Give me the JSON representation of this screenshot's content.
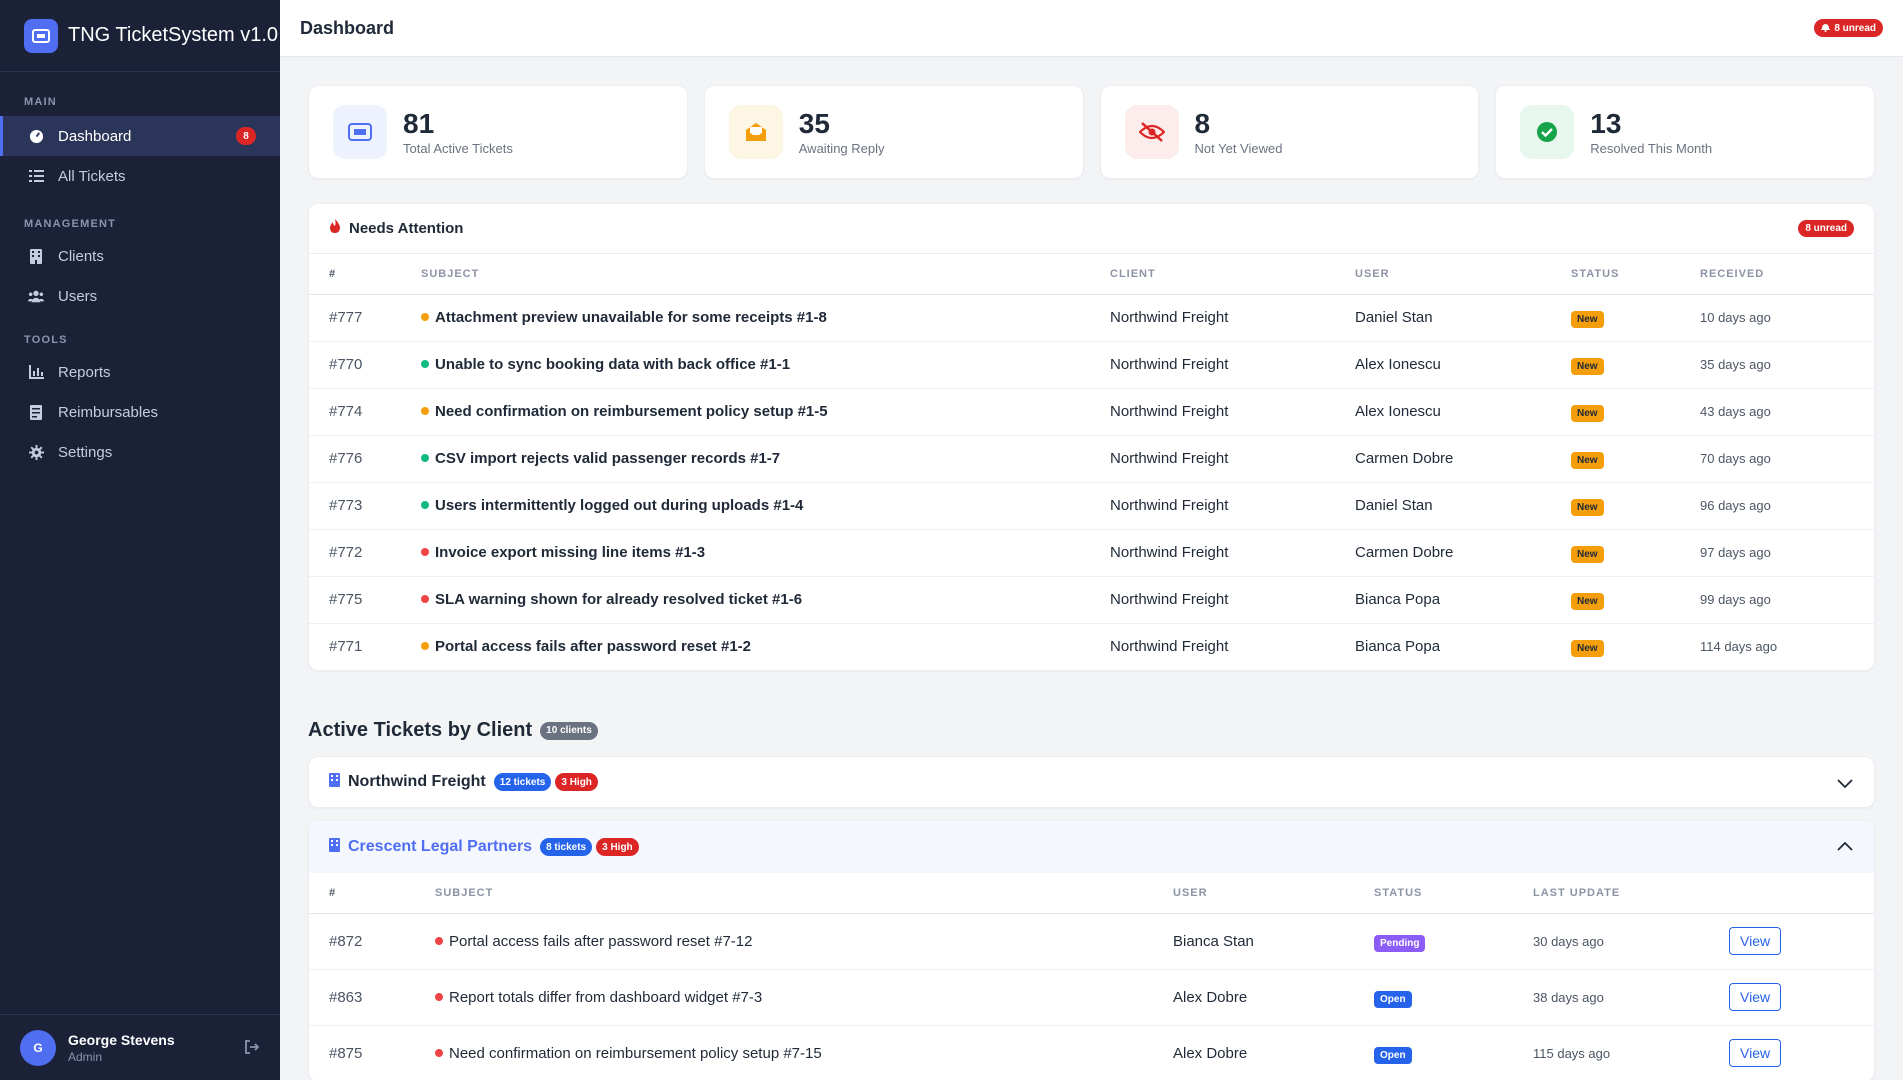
{
  "app": {
    "title": "TNG TicketSystem v1.0"
  },
  "sidebar": {
    "sections": {
      "main": "MAIN",
      "management": "MANAGEMENT",
      "tools": "TOOLS"
    },
    "items": [
      {
        "label": "Dashboard",
        "icon": "gauge-icon",
        "badge": "8"
      },
      {
        "label": "All Tickets",
        "icon": "list-icon"
      },
      {
        "label": "Clients",
        "icon": "building-icon"
      },
      {
        "label": "Users",
        "icon": "users-icon"
      },
      {
        "label": "Reports",
        "icon": "chart-icon"
      },
      {
        "label": "Reimbursables",
        "icon": "receipt-icon"
      },
      {
        "label": "Settings",
        "icon": "gear-icon"
      }
    ],
    "user": {
      "initial": "G",
      "name": "George Stevens",
      "role": "Admin"
    }
  },
  "header": {
    "title": "Dashboard",
    "unread": "8 unread"
  },
  "stats": [
    {
      "value": "81",
      "label": "Total Active Tickets",
      "icon": "ticket-icon",
      "color": "#4f6ef2",
      "bg": "#eef2ff"
    },
    {
      "value": "35",
      "label": "Awaiting Reply",
      "icon": "envelope-open-icon",
      "color": "#f59e0b",
      "bg": "#fef6e4"
    },
    {
      "value": "8",
      "label": "Not Yet Viewed",
      "icon": "eye-slash-icon",
      "color": "#dc2626",
      "bg": "#fdecec"
    },
    {
      "value": "13",
      "label": "Resolved This Month",
      "icon": "check-circle-icon",
      "color": "#16a34a",
      "bg": "#e8f7ee"
    }
  ],
  "attention": {
    "title": "Needs Attention",
    "badge": "8 unread",
    "columns": [
      "#",
      "SUBJECT",
      "CLIENT",
      "USER",
      "STATUS",
      "RECEIVED"
    ],
    "rows": [
      {
        "id": "#777",
        "subject": "Attachment preview unavailable for some receipts #1-8",
        "dot": "#f59e0b",
        "client": "Northwind Freight",
        "user": "Daniel Stan",
        "status": "New",
        "received": "10 days ago"
      },
      {
        "id": "#770",
        "subject": "Unable to sync booking data with back office #1-1",
        "dot": "#10b981",
        "client": "Northwind Freight",
        "user": "Alex Ionescu",
        "status": "New",
        "received": "35 days ago"
      },
      {
        "id": "#774",
        "subject": "Need confirmation on reimbursement policy setup #1-5",
        "dot": "#f59e0b",
        "client": "Northwind Freight",
        "user": "Alex Ionescu",
        "status": "New",
        "received": "43 days ago"
      },
      {
        "id": "#776",
        "subject": "CSV import rejects valid passenger records #1-7",
        "dot": "#10b981",
        "client": "Northwind Freight",
        "user": "Carmen Dobre",
        "status": "New",
        "received": "70 days ago"
      },
      {
        "id": "#773",
        "subject": "Users intermittently logged out during uploads #1-4",
        "dot": "#10b981",
        "client": "Northwind Freight",
        "user": "Daniel Stan",
        "status": "New",
        "received": "96 days ago"
      },
      {
        "id": "#772",
        "subject": "Invoice export missing line items #1-3",
        "dot": "#ef4444",
        "client": "Northwind Freight",
        "user": "Carmen Dobre",
        "status": "New",
        "received": "97 days ago"
      },
      {
        "id": "#775",
        "subject": "SLA warning shown for already resolved ticket #1-6",
        "dot": "#ef4444",
        "client": "Northwind Freight",
        "user": "Bianca Popa",
        "status": "New",
        "received": "99 days ago"
      },
      {
        "id": "#771",
        "subject": "Portal access fails after password reset #1-2",
        "dot": "#f59e0b",
        "client": "Northwind Freight",
        "user": "Bianca Popa",
        "status": "New",
        "received": "114 days ago"
      }
    ]
  },
  "by_client": {
    "title": "Active Tickets by Client",
    "count": "10 clients",
    "clients": [
      {
        "name": "Northwind Freight",
        "tickets": "12 tickets",
        "high": "3 High"
      },
      {
        "name": "Crescent Legal Partners",
        "tickets": "8 tickets",
        "high": "3 High"
      }
    ],
    "columns": [
      "#",
      "SUBJECT",
      "USER",
      "STATUS",
      "LAST UPDATE"
    ],
    "rows": [
      {
        "id": "#872",
        "subject": "Portal access fails after password reset #7-12",
        "user": "Bianca Stan",
        "status": "Pending",
        "updated": "30 days ago",
        "action": "View"
      },
      {
        "id": "#863",
        "subject": "Report totals differ from dashboard widget #7-3",
        "user": "Alex Dobre",
        "status": "Open",
        "updated": "38 days ago",
        "action": "View"
      },
      {
        "id": "#875",
        "subject": "Need confirmation on reimbursement policy setup #7-15",
        "user": "Alex Dobre",
        "status": "Open",
        "updated": "115 days ago",
        "action": "View"
      }
    ]
  }
}
